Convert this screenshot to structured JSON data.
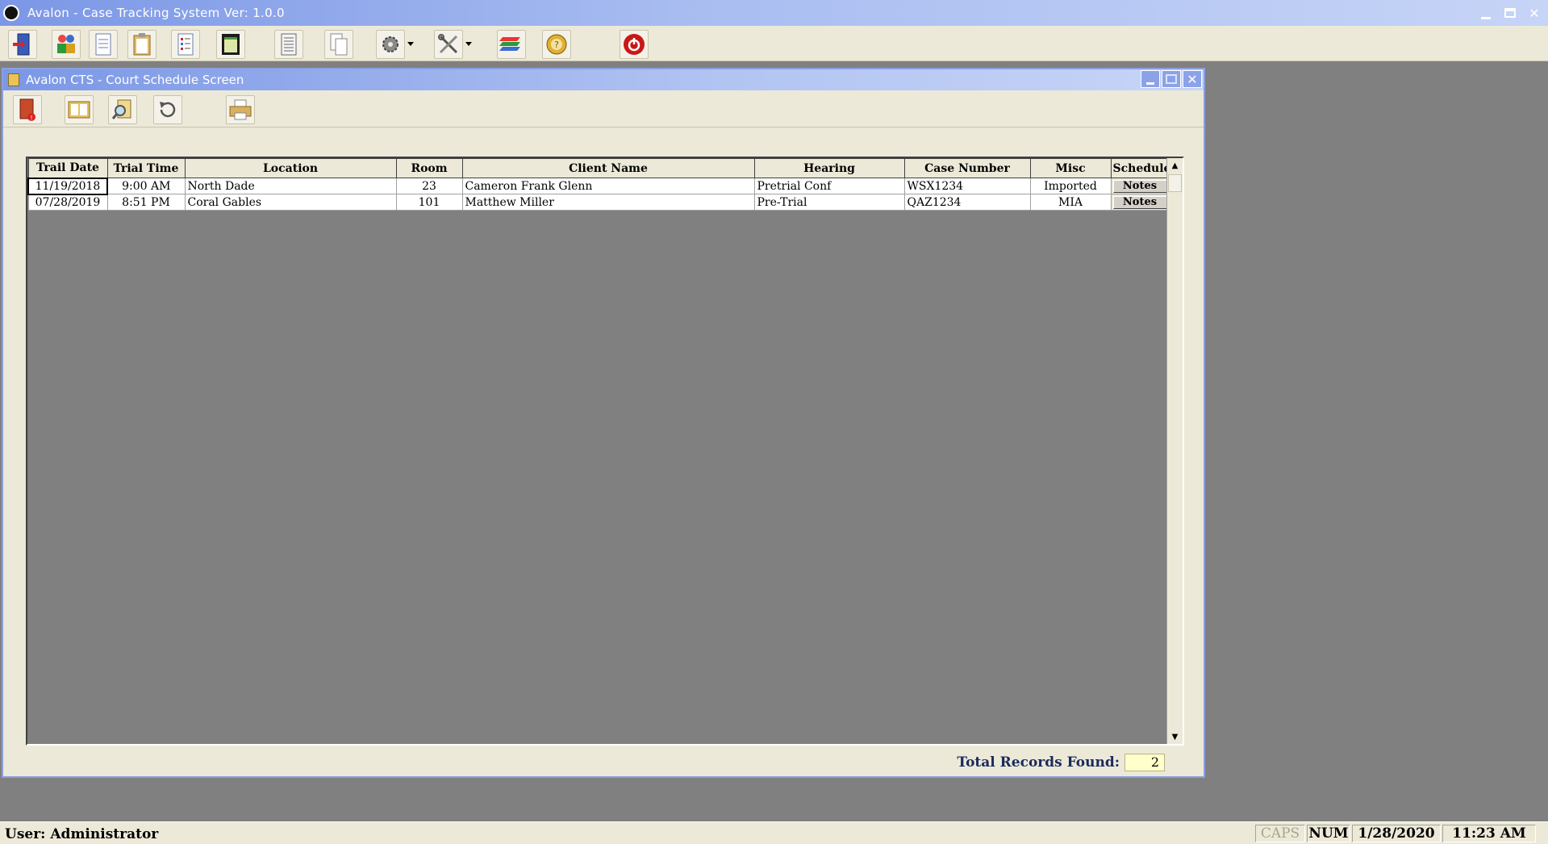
{
  "window": {
    "title": "Avalon - Case Tracking System   Ver: 1.0.0"
  },
  "main_toolbar": {
    "buttons": [
      {
        "icon": "exit-door-icon"
      },
      {
        "icon": "clients-icon"
      },
      {
        "icon": "document-icon"
      },
      {
        "icon": "clipboard-icon"
      },
      {
        "icon": "checklist-icon"
      },
      {
        "icon": "calendar-icon"
      },
      {
        "icon": "list-icon"
      },
      {
        "icon": "copy-icon"
      },
      {
        "icon": "settings-gear-icon"
      },
      {
        "icon": "tools-icon"
      },
      {
        "icon": "database-icon"
      },
      {
        "icon": "help-icon"
      },
      {
        "icon": "power-icon"
      }
    ]
  },
  "child_window": {
    "title": "Avalon CTS - Court Schedule Screen",
    "toolbar": [
      {
        "icon": "close-door-icon"
      },
      {
        "icon": "address-book-icon"
      },
      {
        "icon": "search-magnifier-icon"
      },
      {
        "icon": "refresh-icon"
      },
      {
        "icon": "print-icon"
      }
    ]
  },
  "grid": {
    "columns": [
      "Trail Date",
      "Trial Time",
      "Location",
      "Room",
      "Client Name",
      "Hearing",
      "Case Number",
      "Misc",
      "Schedule"
    ],
    "rows": [
      {
        "date": "11/19/2018",
        "time": "9:00 AM",
        "location": "North Dade",
        "room": "23",
        "client": "Cameron Frank Glenn",
        "hearing": "Pretrial Conf",
        "case": "WSX1234",
        "misc": "Imported",
        "schedule": "Notes"
      },
      {
        "date": "07/28/2019",
        "time": "8:51 PM",
        "location": "Coral Gables",
        "room": "101",
        "client": "Matthew Miller",
        "hearing": "Pre-Trial",
        "case": "QAZ1234",
        "misc": "MIA",
        "schedule": "Notes"
      }
    ]
  },
  "records": {
    "label": "Total Records Found:",
    "value": "2"
  },
  "status": {
    "user": "User: Administrator",
    "caps": "CAPS",
    "num": "NUM",
    "date": "1/28/2020",
    "time": "11:23 AM"
  }
}
